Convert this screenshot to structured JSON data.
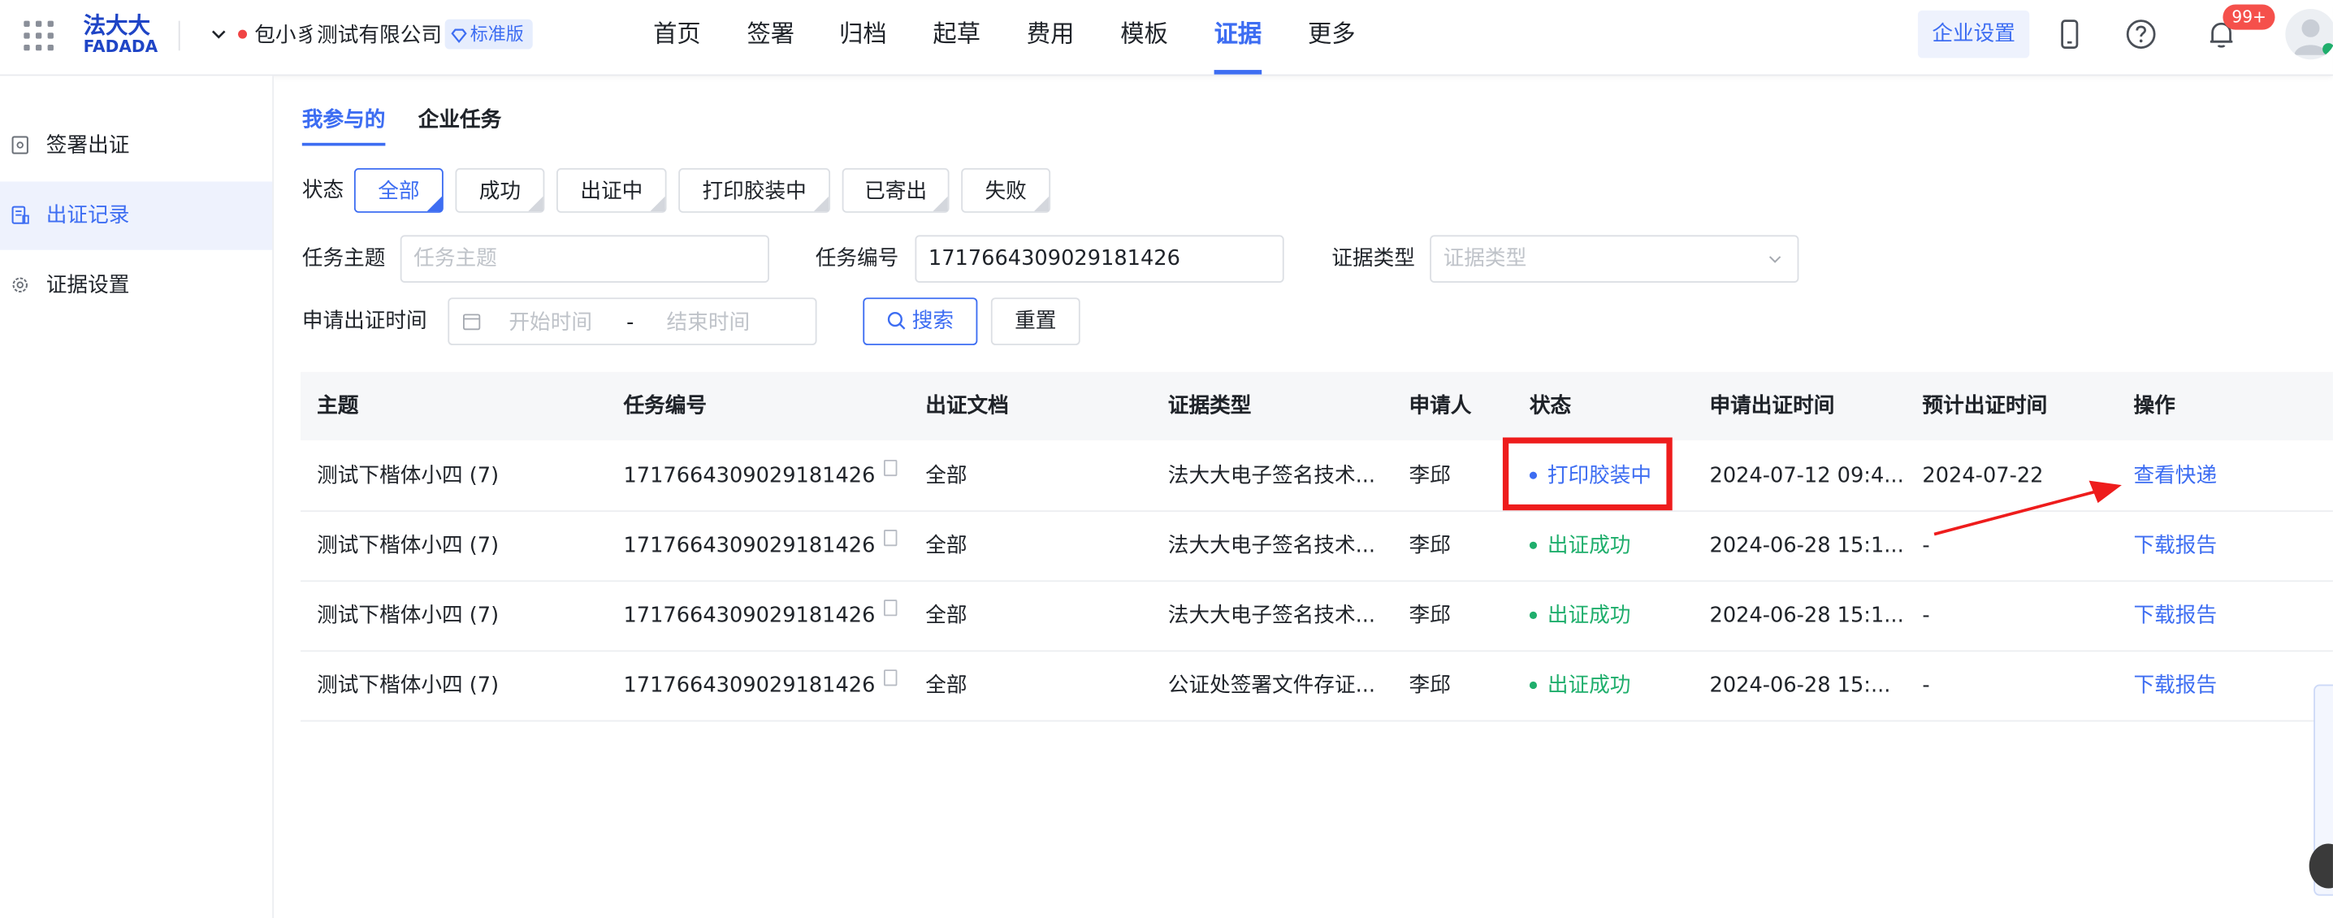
{
  "header": {
    "logo_cn": "法大大",
    "logo_en": "FADADA",
    "org_name": "包小豸测试有限公司",
    "edition_badge": "标准版",
    "nav": [
      "首页",
      "签署",
      "归档",
      "起草",
      "费用",
      "模板",
      "证据",
      "更多"
    ],
    "active_nav": "证据",
    "enterprise_settings": "企业设置",
    "notification_count": "99+",
    "accent_color": "#3d6df2"
  },
  "sidebar": {
    "items": [
      {
        "label": "签署出证",
        "icon": "document-seal-icon"
      },
      {
        "label": "出证记录",
        "icon": "record-list-icon"
      },
      {
        "label": "证据设置",
        "icon": "gear-icon"
      }
    ],
    "active": "出证记录"
  },
  "tabs": [
    {
      "label": "我参与的",
      "active": true
    },
    {
      "label": "企业任务",
      "active": false
    }
  ],
  "filters": {
    "status_label": "状态",
    "status_options": [
      "全部",
      "成功",
      "出证中",
      "打印胶装中",
      "已寄出",
      "失败"
    ],
    "selected_status": "全部",
    "subject_label": "任务主题",
    "subject_placeholder": "任务主题",
    "task_no_label": "任务编号",
    "task_no_value": "1717664309029181426",
    "evidence_type_label": "证据类型",
    "evidence_type_placeholder": "证据类型",
    "apply_time_label": "申请出证时间",
    "start_placeholder": "开始时间",
    "date_separator": "-",
    "end_placeholder": "结束时间",
    "search_button": "搜索",
    "reset_button": "重置"
  },
  "table": {
    "columns": [
      "主题",
      "任务编号",
      "出证文档",
      "证据类型",
      "申请人",
      "状态",
      "申请出证时间",
      "预计出证时间",
      "操作"
    ],
    "rows": [
      {
        "subject": "测试下楷体小四 (7)",
        "task_no": "1717664309029181426",
        "doc": "全部",
        "type": "法大大电子签名技术...",
        "applicant": "李邱",
        "status": "打印胶装中",
        "status_color": "#3d6df2",
        "apply_time": "2024-07-12 09:4...",
        "expected_time": "2024-07-22",
        "action": "查看快递"
      },
      {
        "subject": "测试下楷体小四 (7)",
        "task_no": "1717664309029181426",
        "doc": "全部",
        "type": "法大大电子签名技术...",
        "applicant": "李邱",
        "status": "出证成功",
        "status_color": "#1fae6c",
        "apply_time": "2024-06-28 15:1...",
        "expected_time": "-",
        "action": "下载报告"
      },
      {
        "subject": "测试下楷体小四 (7)",
        "task_no": "1717664309029181426",
        "doc": "全部",
        "type": "法大大电子签名技术...",
        "applicant": "李邱",
        "status": "出证成功",
        "status_color": "#1fae6c",
        "apply_time": "2024-06-28 15:1...",
        "expected_time": "-",
        "action": "下载报告"
      },
      {
        "subject": "测试下楷体小四 (7)",
        "task_no": "1717664309029181426",
        "doc": "全部",
        "type": "公证处签署文件存证...",
        "applicant": "李邱",
        "status": "出证成功",
        "status_color": "#1fae6c",
        "apply_time": "2024-06-28 15:...",
        "expected_time": "-",
        "action": "下载报告"
      }
    ]
  },
  "annotation": {
    "highlight_color": "#ee1c1c",
    "highlighted_status": "打印胶装中",
    "arrow_target": "查看快递"
  }
}
